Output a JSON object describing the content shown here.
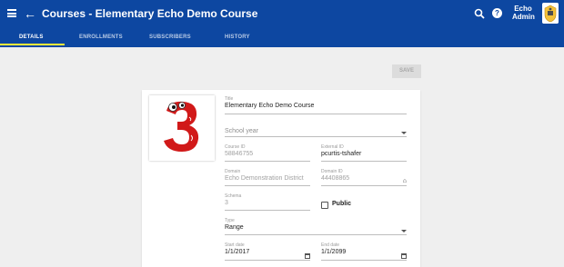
{
  "header": {
    "title": "Courses - Elementary Echo Demo Course",
    "user_line1": "Echo",
    "user_line2": "Admin",
    "icons": [
      "menu-icon",
      "back-arrow-icon",
      "search-icon",
      "help-icon",
      "avatar"
    ]
  },
  "tabs": [
    {
      "label": "DETAILS",
      "active": true
    },
    {
      "label": "ENROLLMENTS",
      "active": false
    },
    {
      "label": "SUBSCRIBERS",
      "active": false
    },
    {
      "label": "HISTORY",
      "active": false
    }
  ],
  "toolbar": {
    "save_label": "SAVE"
  },
  "form": {
    "title": {
      "label": "Title",
      "value": "Elementary Echo Demo Course"
    },
    "school_year": {
      "placeholder": "School year"
    },
    "course_id": {
      "label": "Course ID",
      "value": "58846755"
    },
    "external_id": {
      "label": "External ID",
      "value": "pcurtis-tshafer"
    },
    "domain": {
      "label": "Domain",
      "value": "Echo Demonstration District"
    },
    "domain_id": {
      "label": "Domain ID",
      "value": "44408865"
    },
    "schema": {
      "label": "Schema",
      "value": "3"
    },
    "public": {
      "label": "Public",
      "checked": false
    },
    "type": {
      "label": "Type",
      "value": "Range"
    },
    "start_date": {
      "label": "Start date",
      "value": "1/1/2017"
    },
    "end_date": {
      "label": "End date",
      "value": "1/1/2099"
    }
  },
  "colors": {
    "header": "#0d47a1",
    "tab_indicator": "#ffeb3b",
    "logo_red": "#d11919"
  }
}
